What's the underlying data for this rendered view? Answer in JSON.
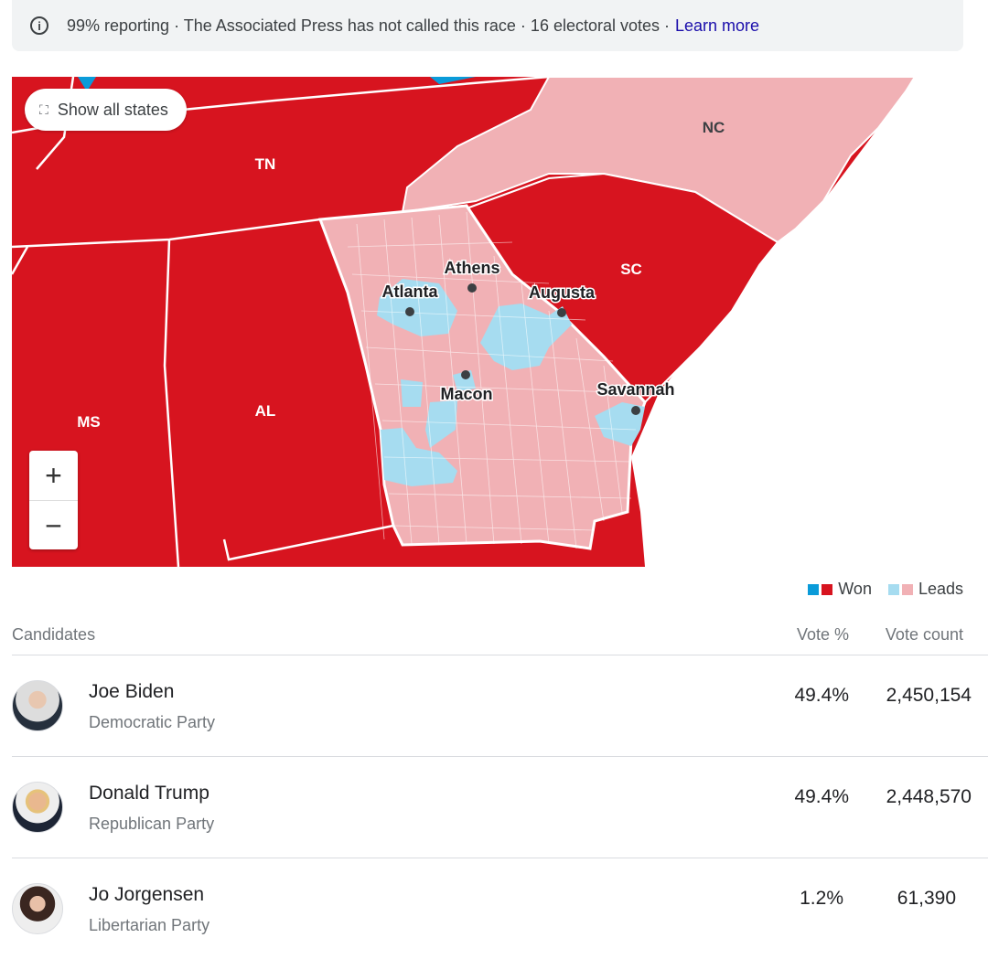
{
  "banner": {
    "icon": "info-icon",
    "text": "99% reporting · The Associated Press has not called this race · 16 electoral votes ·",
    "link": "Learn more"
  },
  "map": {
    "show_all_label": "Show all states",
    "zoom_in": "+",
    "zoom_out": "−",
    "states": {
      "tn": "TN",
      "nc": "NC",
      "sc": "SC",
      "ms": "MS",
      "al": "AL"
    },
    "cities": {
      "athens": "Athens",
      "atlanta": "Atlanta",
      "augusta": "Augusta",
      "macon": "Macon",
      "savannah": "Savannah"
    },
    "colors": {
      "rep_won": "#d7141f",
      "dem_won": "#0a9bd9",
      "rep_leads": "#f1b1b5",
      "dem_leads": "#a6dcf0"
    }
  },
  "legend": {
    "won": "Won",
    "leads": "Leads"
  },
  "table": {
    "headers": {
      "candidates": "Candidates",
      "vote_pct": "Vote %",
      "vote_count": "Vote count"
    },
    "rows": [
      {
        "name": "Joe Biden",
        "party": "Democratic Party",
        "pct": "49.4%",
        "count": "2,450,154"
      },
      {
        "name": "Donald Trump",
        "party": "Republican Party",
        "pct": "49.4%",
        "count": "2,448,570"
      },
      {
        "name": "Jo Jorgensen",
        "party": "Libertarian Party",
        "pct": "1.2%",
        "count": "61,390"
      }
    ]
  }
}
